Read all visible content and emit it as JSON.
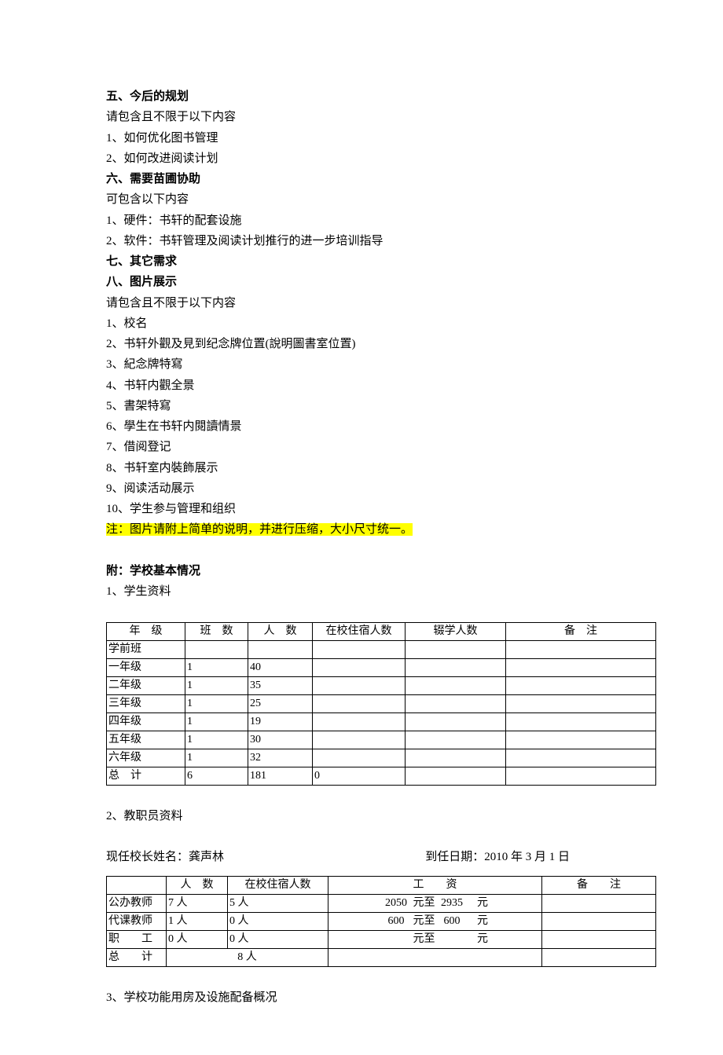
{
  "sections": {
    "s5_title": "五、今后的规划",
    "s5_intro": "请包含且不限于以下内容",
    "s5_item1": "1、如何优化图书管理",
    "s5_item2": "2、如何改进阅读计划",
    "s6_title": "六、需要苗圃协助",
    "s6_intro": "可包含以下内容",
    "s6_item1": "1、硬件：书轩的配套设施",
    "s6_item2": "2、软件：书轩管理及阅读计划推行的进一步培训指导",
    "s7_title": "七、其它需求",
    "s8_title": "八、图片展示",
    "s8_intro": "请包含且不限于以下内容",
    "s8_item1": "1、校名",
    "s8_item2": "2、书轩外觀及見到纪念牌位置(說明圖書室位置)",
    "s8_item3": "3、紀念牌特寫",
    "s8_item4": "4、书轩内觀全景",
    "s8_item5": "5、書架特寫",
    "s8_item6": "6、學生在书轩内閱讀情景",
    "s8_item7": "7、借阅登记",
    "s8_item8": "8、书轩室内裝飾展示",
    "s8_item9": "9、阅读活动展示",
    "s8_item10": "10、学生参与管理和组织",
    "s8_note": "注：图片请附上简单的说明，并进行压缩，大小尺寸统一。"
  },
  "appendix": {
    "title": "附：学校基本情况",
    "sub1": "1、学生资料",
    "sub2": "2、教职员资料",
    "sub3": "3、学校功能用房及设施配备概况",
    "principal_label": "现任校长姓名：",
    "principal_name": "龚声林",
    "date_label": "到任日期：",
    "date_value": "2010 年 3 月 1 日"
  },
  "table1": {
    "headers": {
      "c1": "年　级",
      "c2": "班　数",
      "c3": "人　数",
      "c4": "在校住宿人数",
      "c5": "辍学人数",
      "c6": "备　注"
    },
    "rows": [
      {
        "grade": "学前班",
        "classes": "",
        "people": "",
        "board": "",
        "drop": "",
        "note": ""
      },
      {
        "grade": "一年级",
        "classes": "1",
        "people": "40",
        "board": "",
        "drop": "",
        "note": ""
      },
      {
        "grade": "二年级",
        "classes": "1",
        "people": "35",
        "board": "",
        "drop": "",
        "note": ""
      },
      {
        "grade": "三年级",
        "classes": "1",
        "people": "25",
        "board": "",
        "drop": "",
        "note": ""
      },
      {
        "grade": "四年级",
        "classes": "1",
        "people": "19",
        "board": "",
        "drop": "",
        "note": ""
      },
      {
        "grade": "五年级",
        "classes": "1",
        "people": "30",
        "board": "",
        "drop": "",
        "note": ""
      },
      {
        "grade": "六年级",
        "classes": "1",
        "people": "32",
        "board": "",
        "drop": "",
        "note": ""
      },
      {
        "grade": "总　计",
        "classes": "6",
        "people": "181",
        "board": "0",
        "drop": "",
        "note": ""
      }
    ]
  },
  "table2": {
    "headers": {
      "c1": "",
      "c2": "人　数",
      "c3": "在校住宿人数",
      "c4": "工　　资",
      "c5": "备　　注"
    },
    "unit_person": "人",
    "unit_yuan": "元",
    "word_to": "元至",
    "rows": [
      {
        "role": "公办教师",
        "people": "7",
        "board": "5",
        "sal_from": "2050",
        "sal_to": "2935",
        "note": ""
      },
      {
        "role": "代课教师",
        "people": "1",
        "board": "0",
        "sal_from": "600",
        "sal_to": "600",
        "note": ""
      },
      {
        "role": "职　　工",
        "people": "0",
        "board": "0",
        "sal_from": "",
        "sal_to": "",
        "note": ""
      }
    ],
    "total_label": "总　　计",
    "total_people": "8"
  }
}
